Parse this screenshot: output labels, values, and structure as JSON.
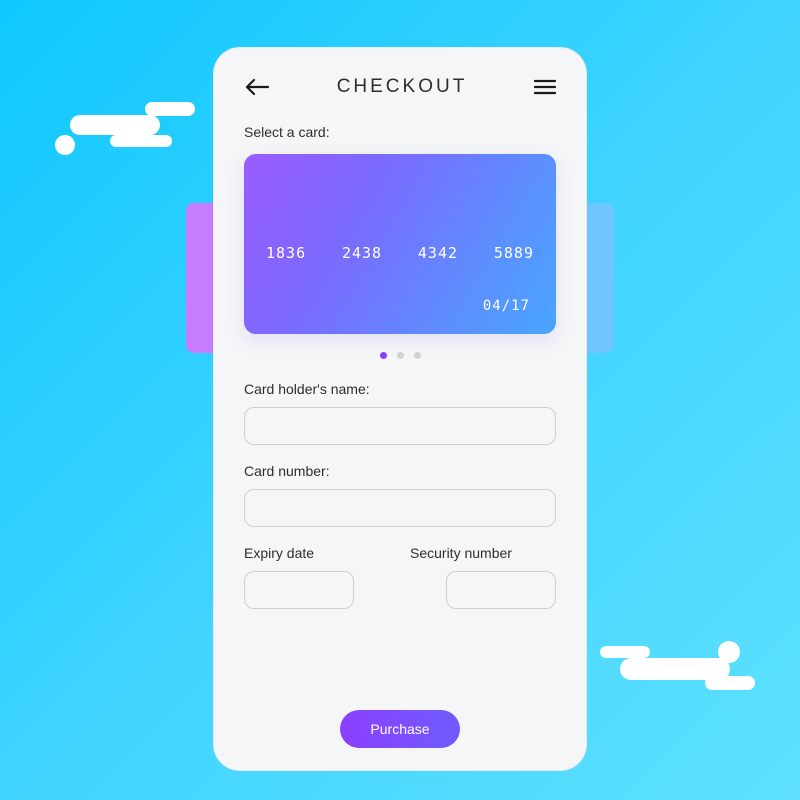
{
  "header": {
    "title": "CHECKOUT"
  },
  "select_card_label": "Select a card:",
  "card": {
    "segments": [
      "1836",
      "2438",
      "4342",
      "5889"
    ],
    "expiry": "04/17"
  },
  "carousel": {
    "count": 3,
    "active_index": 0
  },
  "form": {
    "holder_label": "Card holder's name:",
    "number_label": "Card number:",
    "expiry_label": "Expiry date",
    "security_label": "Security number",
    "holder_value": "",
    "number_value": "",
    "expiry_value": "",
    "security_value": ""
  },
  "purchase_label": "Purchase",
  "colors": {
    "accent": "#8a3dff",
    "card_gradient_start": "#9a5bff",
    "card_gradient_end": "#48a6ff",
    "background_start": "#0fc7ff",
    "background_end": "#5fe0ff"
  }
}
